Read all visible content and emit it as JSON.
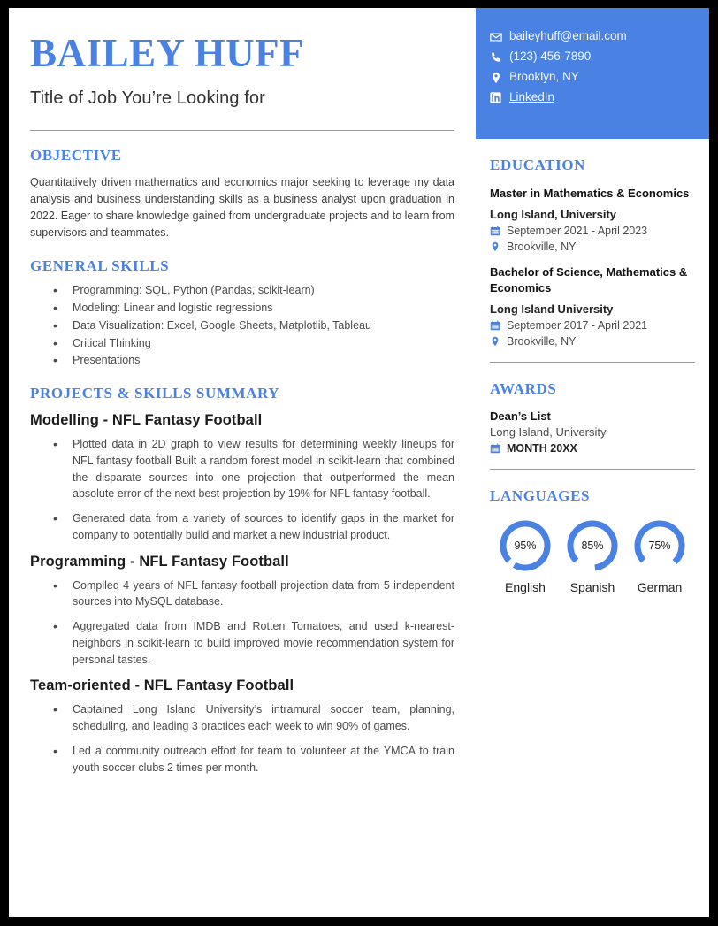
{
  "theme": {
    "accent": "#4a82e4",
    "text_dark": "#1b1b1b",
    "text_body": "#4a4a4a",
    "rule": "#9a9a9a",
    "page_bg": "#ffffff",
    "frame": "#000000"
  },
  "header": {
    "name": "BAILEY HUFF",
    "job_title": "Title of Job You’re Looking for"
  },
  "contact": {
    "items": [
      {
        "icon": "envelope-icon",
        "label": "baileyhuff@email.com",
        "link": false
      },
      {
        "icon": "phone-icon",
        "label": "(123) 456-7890",
        "link": false
      },
      {
        "icon": "map-pin-icon",
        "label": "Brooklyn, NY",
        "link": false
      },
      {
        "icon": "linkedin-icon",
        "label": "LinkedIn",
        "link": true
      }
    ]
  },
  "objective": {
    "heading": "OBJECTIVE",
    "body": "Quantitatively driven mathematics and economics major seeking to leverage my data analysis and business understanding skills as a business analyst upon graduation in 2022. Eager to share knowledge gained from undergraduate projects and to learn from supervisors and teammates."
  },
  "general_skills": {
    "heading": "GENERAL SKILLS",
    "items": [
      "Programming: SQL, Python (Pandas, scikit-learn)",
      "Modeling: Linear and logistic regressions",
      "Data Visualization: Excel, Google Sheets, Matplotlib, Tableau",
      "Critical Thinking",
      "Presentations"
    ]
  },
  "projects": {
    "heading": "PROJECTS & SKILLS SUMMARY",
    "groups": [
      {
        "title": "Modelling - NFL Fantasy Football",
        "bullets": [
          "Plotted data in 2D graph to view results for determining weekly lineups for NFL fantasy football Built a random forest model in scikit-learn that combined  the disparate sources into one projection that outperformed the mean absolute error of the next best projection by 19% for NFL fantasy football.",
          "Generated data from a variety of sources to identify gaps in the market for company to potentially build and market a new industrial product."
        ]
      },
      {
        "title": "Programming - NFL Fantasy Football",
        "bullets": [
          "Compiled 4 years of NFL fantasy football projection data from 5 independent sources into MySQL database.",
          "Aggregated data from IMDB and Rotten Tomatoes, and used k-nearest-neighbors in scikit-learn to build improved movie recommendation system for personal tastes."
        ]
      },
      {
        "title": "Team-oriented - NFL Fantasy Football",
        "bullets": [
          "Captained Long Island University’s intramural soccer team, planning, scheduling, and leading 3 practices each week to win 90% of games.",
          "Led a community outreach effort for team to volunteer at the YMCA to train youth soccer clubs 2 times per month."
        ]
      }
    ]
  },
  "education": {
    "heading": "EDUCATION",
    "entries": [
      {
        "degree": "Master in Mathematics & Economics",
        "school": "Long Island, University",
        "dates": "September 2021 - April 2023",
        "location": "Brookville, NY"
      },
      {
        "degree": "Bachelor of Science, Mathematics & Economics",
        "school": "Long Island University",
        "dates": "September 2017 - April 2021",
        "location": "Brookville, NY"
      }
    ]
  },
  "awards": {
    "heading": "AWARDS",
    "entries": [
      {
        "name": "Dean’s List",
        "org": "Long Island, University",
        "date": "MONTH 20XX"
      }
    ]
  },
  "languages": {
    "heading": "LANGUAGES",
    "items": [
      {
        "label": "English",
        "percent": 95,
        "percent_text": "95%"
      },
      {
        "label": "Spanish",
        "percent": 85,
        "percent_text": "85%"
      },
      {
        "label": "German",
        "percent": 75,
        "percent_text": "75%"
      }
    ]
  }
}
